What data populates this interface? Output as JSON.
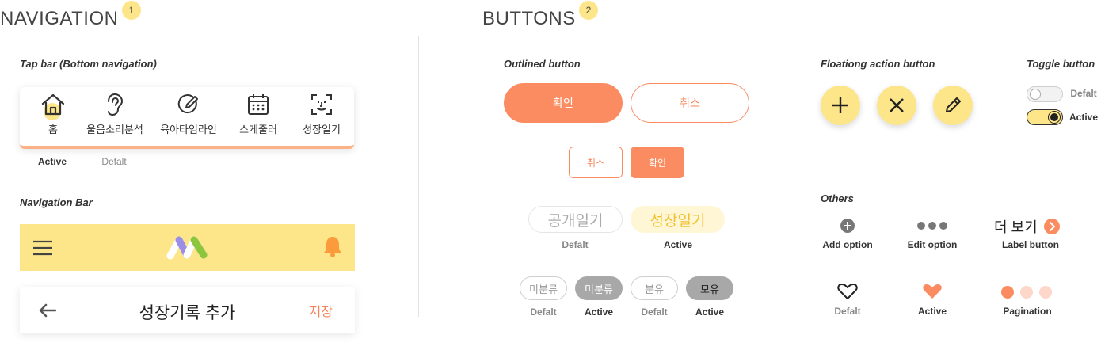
{
  "navigation": {
    "heading": "NAVIGATION",
    "badge": "1",
    "tabbar": {
      "title": "Tap bar (Bottom navigation)",
      "tabs": [
        {
          "label": "홈",
          "icon": "home-icon"
        },
        {
          "label": "울음소리분석",
          "icon": "ear-icon"
        },
        {
          "label": "육아타임라인",
          "icon": "pencil-circle-icon"
        },
        {
          "label": "스케줄러",
          "icon": "calendar-icon"
        },
        {
          "label": "성장일기",
          "icon": "face-scan-icon"
        }
      ],
      "active_caption": "Active",
      "default_caption": "Defalt"
    },
    "navbar": {
      "title": "Navigation Bar",
      "menu_icon": "menu-icon",
      "logo_icon": "logo-icon",
      "bell_icon": "bell-icon"
    },
    "header": {
      "back_icon": "arrow-left-icon",
      "title": "성장기록 추가",
      "save": "저장"
    }
  },
  "buttons": {
    "heading": "BUTTONS",
    "badge": "2",
    "outlined": {
      "title": "Outlined button",
      "confirm": "확인",
      "cancel": "취소",
      "cancel_small": "취소",
      "confirm_small": "확인"
    },
    "diary": {
      "public": "공개일기",
      "growth": "성장일기",
      "default_caption": "Defalt",
      "active_caption": "Active"
    },
    "chips": [
      {
        "label": "미분류",
        "caption": "Defalt"
      },
      {
        "label": "미분류",
        "caption": "Active"
      },
      {
        "label": "분유",
        "caption": "Defalt"
      },
      {
        "label": "모유",
        "caption": "Active"
      }
    ],
    "fab": {
      "title": "Floationg action button",
      "icons": [
        "plus-icon",
        "close-icon",
        "pencil-icon"
      ]
    },
    "toggle": {
      "title": "Toggle button",
      "default_caption": "Defalt",
      "active_caption": "Active"
    },
    "others": {
      "title": "Others",
      "add_option": "Add option",
      "edit_option": "Edit option",
      "more_label": "더 보기",
      "label_button": "Label button",
      "heart_default": "Defalt",
      "heart_active": "Active",
      "pagination": "Pagination"
    }
  },
  "colors": {
    "accent_orange": "#fb8c61",
    "accent_yellow": "#fde58a",
    "text_dark": "#333333"
  }
}
